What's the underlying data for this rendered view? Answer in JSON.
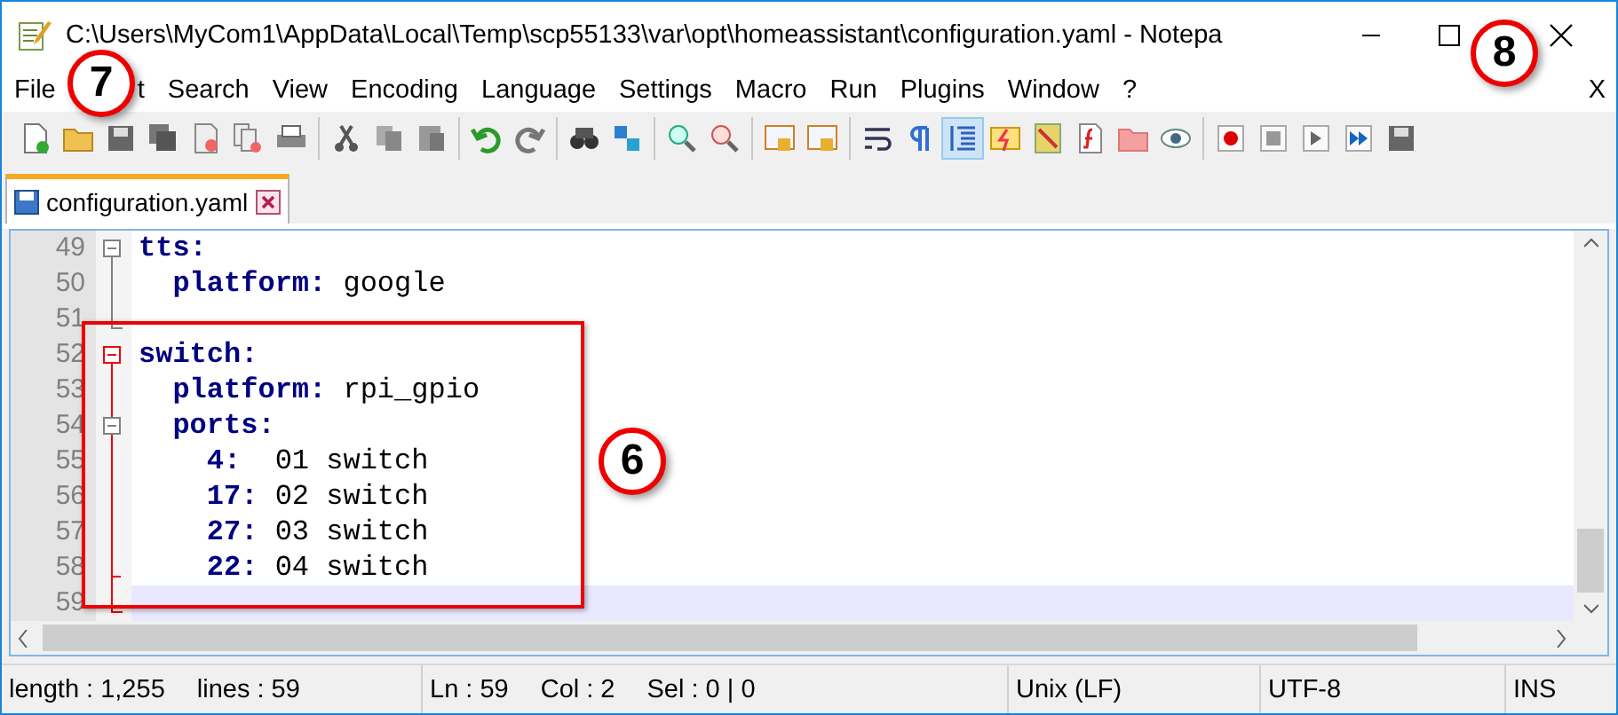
{
  "window": {
    "title": "C:\\Users\\MyCom1\\AppData\\Local\\Temp\\scp55133\\var\\opt\\homeassistant\\configuration.yaml - Notepa"
  },
  "menu": {
    "items": [
      "File",
      "t",
      "Search",
      "View",
      "Encoding",
      "Language",
      "Settings",
      "Macro",
      "Run",
      "Plugins",
      "Window",
      "?"
    ],
    "close_label": "X"
  },
  "toolbar": [
    [
      {
        "kind": "new",
        "pressed": false
      },
      {
        "kind": "open",
        "pressed": false
      },
      {
        "kind": "save",
        "pressed": false
      },
      {
        "kind": "save-all",
        "pressed": false
      },
      {
        "kind": "close",
        "pressed": false
      },
      {
        "kind": "close-all",
        "pressed": false
      },
      {
        "kind": "print",
        "pressed": false
      }
    ],
    [
      {
        "kind": "cut",
        "pressed": false
      },
      {
        "kind": "copy",
        "pressed": false
      },
      {
        "kind": "paste",
        "pressed": false
      }
    ],
    [
      {
        "kind": "undo",
        "pressed": false
      },
      {
        "kind": "redo",
        "pressed": false
      }
    ],
    [
      {
        "kind": "find",
        "pressed": false
      },
      {
        "kind": "replace",
        "pressed": false
      }
    ],
    [
      {
        "kind": "zoom-in",
        "pressed": false
      },
      {
        "kind": "zoom-out",
        "pressed": false
      }
    ],
    [
      {
        "kind": "sync-v",
        "pressed": false
      },
      {
        "kind": "sync-h",
        "pressed": false
      }
    ],
    [
      {
        "kind": "wrap",
        "pressed": false
      },
      {
        "kind": "pilcrow",
        "pressed": false
      },
      {
        "kind": "indent",
        "pressed": true
      },
      {
        "kind": "lang",
        "pressed": false
      },
      {
        "kind": "map",
        "pressed": false
      },
      {
        "kind": "function",
        "pressed": false
      },
      {
        "kind": "folder",
        "pressed": false
      },
      {
        "kind": "eye",
        "pressed": false
      }
    ],
    [
      {
        "kind": "record",
        "pressed": false
      },
      {
        "kind": "stop",
        "pressed": false
      },
      {
        "kind": "play",
        "pressed": false
      },
      {
        "kind": "play-multi",
        "pressed": false
      },
      {
        "kind": "save-macro",
        "pressed": false
      }
    ]
  ],
  "tabs": [
    {
      "label": "configuration.yaml",
      "selected": true
    }
  ],
  "editor": {
    "lines": [
      {
        "number": "49",
        "kind": "begin",
        "highlighted": false,
        "current": false,
        "key": "tts:"
      },
      {
        "number": "50",
        "kind": "middle",
        "highlighted": false,
        "current": false,
        "key": "  platform:",
        "value": " google"
      },
      {
        "number": "51",
        "kind": "end",
        "highlighted": false,
        "current": false
      },
      {
        "number": "52",
        "kind": "begin",
        "highlighted": true,
        "current": false,
        "key": "switch:"
      },
      {
        "number": "53",
        "kind": "middle",
        "highlighted": true,
        "current": false,
        "key": "  platform:",
        "value": " rpi_gpio"
      },
      {
        "number": "54",
        "kind": "nested-begin",
        "highlighted": true,
        "current": false,
        "key": "  ports:"
      },
      {
        "number": "55",
        "kind": "middle",
        "highlighted": true,
        "current": false,
        "key": "    4:",
        "value": "  01 switch"
      },
      {
        "number": "56",
        "kind": "middle",
        "highlighted": true,
        "current": false,
        "key": "    17:",
        "value": " 02 switch"
      },
      {
        "number": "57",
        "kind": "middle",
        "highlighted": true,
        "current": false,
        "key": "    27:",
        "value": " 03 switch"
      },
      {
        "number": "58",
        "kind": "nested-end",
        "highlighted": true,
        "current": false,
        "key": "    22:",
        "value": " 04 switch"
      },
      {
        "number": "59",
        "kind": "end",
        "highlighted": true,
        "current": true
      }
    ]
  },
  "callouts": [
    {
      "label": "7"
    },
    {
      "label": "8"
    },
    {
      "label": "6"
    }
  ],
  "status_bar": [
    {
      "texts": [
        "length : 1,255",
        "lines : 59"
      ]
    },
    {
      "texts": [
        "Ln : 59",
        "Col : 2",
        "Sel : 0 | 0"
      ]
    },
    {
      "texts": [
        "Unix (LF)"
      ]
    },
    {
      "texts": [
        "UTF-8"
      ]
    },
    {
      "texts": [
        "INS"
      ]
    }
  ]
}
